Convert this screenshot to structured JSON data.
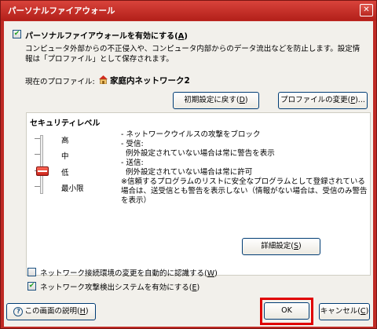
{
  "window": {
    "title": "パーソナルファイアウォール",
    "close_glyph": "✕"
  },
  "enable": {
    "label": "パーソナルファイアウォールを有効にする(",
    "accel": "A",
    "label_end": ")",
    "checked_glyph": "✔",
    "desc1": "コンピュータ外部からの不正侵入や、コンピュータ内部からのデータ流出などを防止します。設定情",
    "desc2": "報は「プロファイル」として保存されます。"
  },
  "profile": {
    "label": "現在のプロファイル:",
    "name": "家庭内ネットワーク2",
    "reset_label": "初期設定に戻す(",
    "reset_accel": "D",
    "change_label": "プロファイルの変更(",
    "change_accel": "P",
    "change_end": ")..."
  },
  "security": {
    "title": "セキュリティレベル",
    "levels": [
      "高",
      "中",
      "低",
      "最小限"
    ],
    "selected_level": "低",
    "description": [
      "- ネットワークウイルスの攻撃をブロック",
      "- 受信:",
      "   例外設定されていない場合は常に警告を表示",
      "- 送信:",
      "   例外設定されていない場合は常に許可",
      "※信頼するプログラムのリストに安全なプログラムとして登録されている",
      "場合は、送受信とも警告を表示しない（情報がない場合は、受信のみ警告",
      "を表示）"
    ],
    "detail_label": "詳細設定(",
    "detail_accel": "S"
  },
  "options": {
    "auto_detect_label": "ネットワーク接続環境の変更を自動的に認識する(",
    "auto_detect_accel": "W",
    "auto_detect_checked": false,
    "ids_label": "ネットワーク攻撃検出システムを有効にする(",
    "ids_accel": "E",
    "ids_checked": true
  },
  "footer": {
    "help_label": "この画面の説明(",
    "help_accel": "H",
    "help_icon": "?",
    "ok_label": "OK",
    "cancel_label": "キャンセル(",
    "cancel_accel": "C"
  },
  "colors": {
    "title_bar": "#bf2a24",
    "highlight": "#e00000",
    "check": "#21a121"
  }
}
